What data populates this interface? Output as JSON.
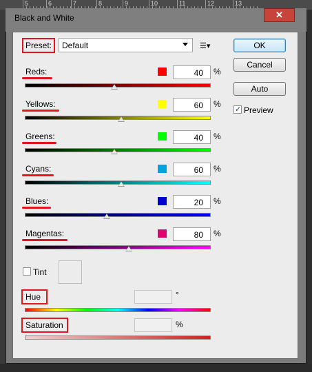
{
  "ruler": {
    "marks": [
      "5",
      "6",
      "7",
      "8",
      "9",
      "10",
      "11",
      "12",
      "13"
    ]
  },
  "window": {
    "title": "Black and White",
    "close_glyph": "✕"
  },
  "preset": {
    "label": "Preset:",
    "value": "Default",
    "options_glyph": "☰▾"
  },
  "buttons": {
    "ok": "OK",
    "cancel": "Cancel",
    "auto": "Auto"
  },
  "preview": {
    "label": "Preview",
    "checked": true
  },
  "sliders": [
    {
      "name": "reds",
      "label": "Reds:",
      "value": "40",
      "unit": "%",
      "swatch": "#ff0000",
      "gradient": [
        "#000000",
        "#ff0000"
      ]
    },
    {
      "name": "yellows",
      "label": "Yellows:",
      "value": "60",
      "unit": "%",
      "swatch": "#ffff00",
      "gradient": [
        "#000000",
        "#ffff00"
      ]
    },
    {
      "name": "greens",
      "label": "Greens:",
      "value": "40",
      "unit": "%",
      "swatch": "#00ff00",
      "gradient": [
        "#000000",
        "#00ff00"
      ]
    },
    {
      "name": "cyans",
      "label": "Cyans:",
      "value": "60",
      "unit": "%",
      "swatch": "#00a3e0",
      "gradient": [
        "#000000",
        "#00ffff"
      ]
    },
    {
      "name": "blues",
      "label": "Blues:",
      "value": "20",
      "unit": "%",
      "swatch": "#0000d0",
      "gradient": [
        "#000000",
        "#0000ff"
      ]
    },
    {
      "name": "magentas",
      "label": "Magentas:",
      "value": "80",
      "unit": "%",
      "swatch": "#e0006e",
      "gradient": [
        "#000000",
        "#ff00ff"
      ]
    }
  ],
  "tint": {
    "label": "Tint",
    "checked": false
  },
  "hue": {
    "label": "Hue",
    "value": "",
    "unit": "°"
  },
  "saturation": {
    "label": "Saturation",
    "value": "",
    "unit": "%"
  },
  "colors": {
    "annotation": "#e3141d"
  }
}
